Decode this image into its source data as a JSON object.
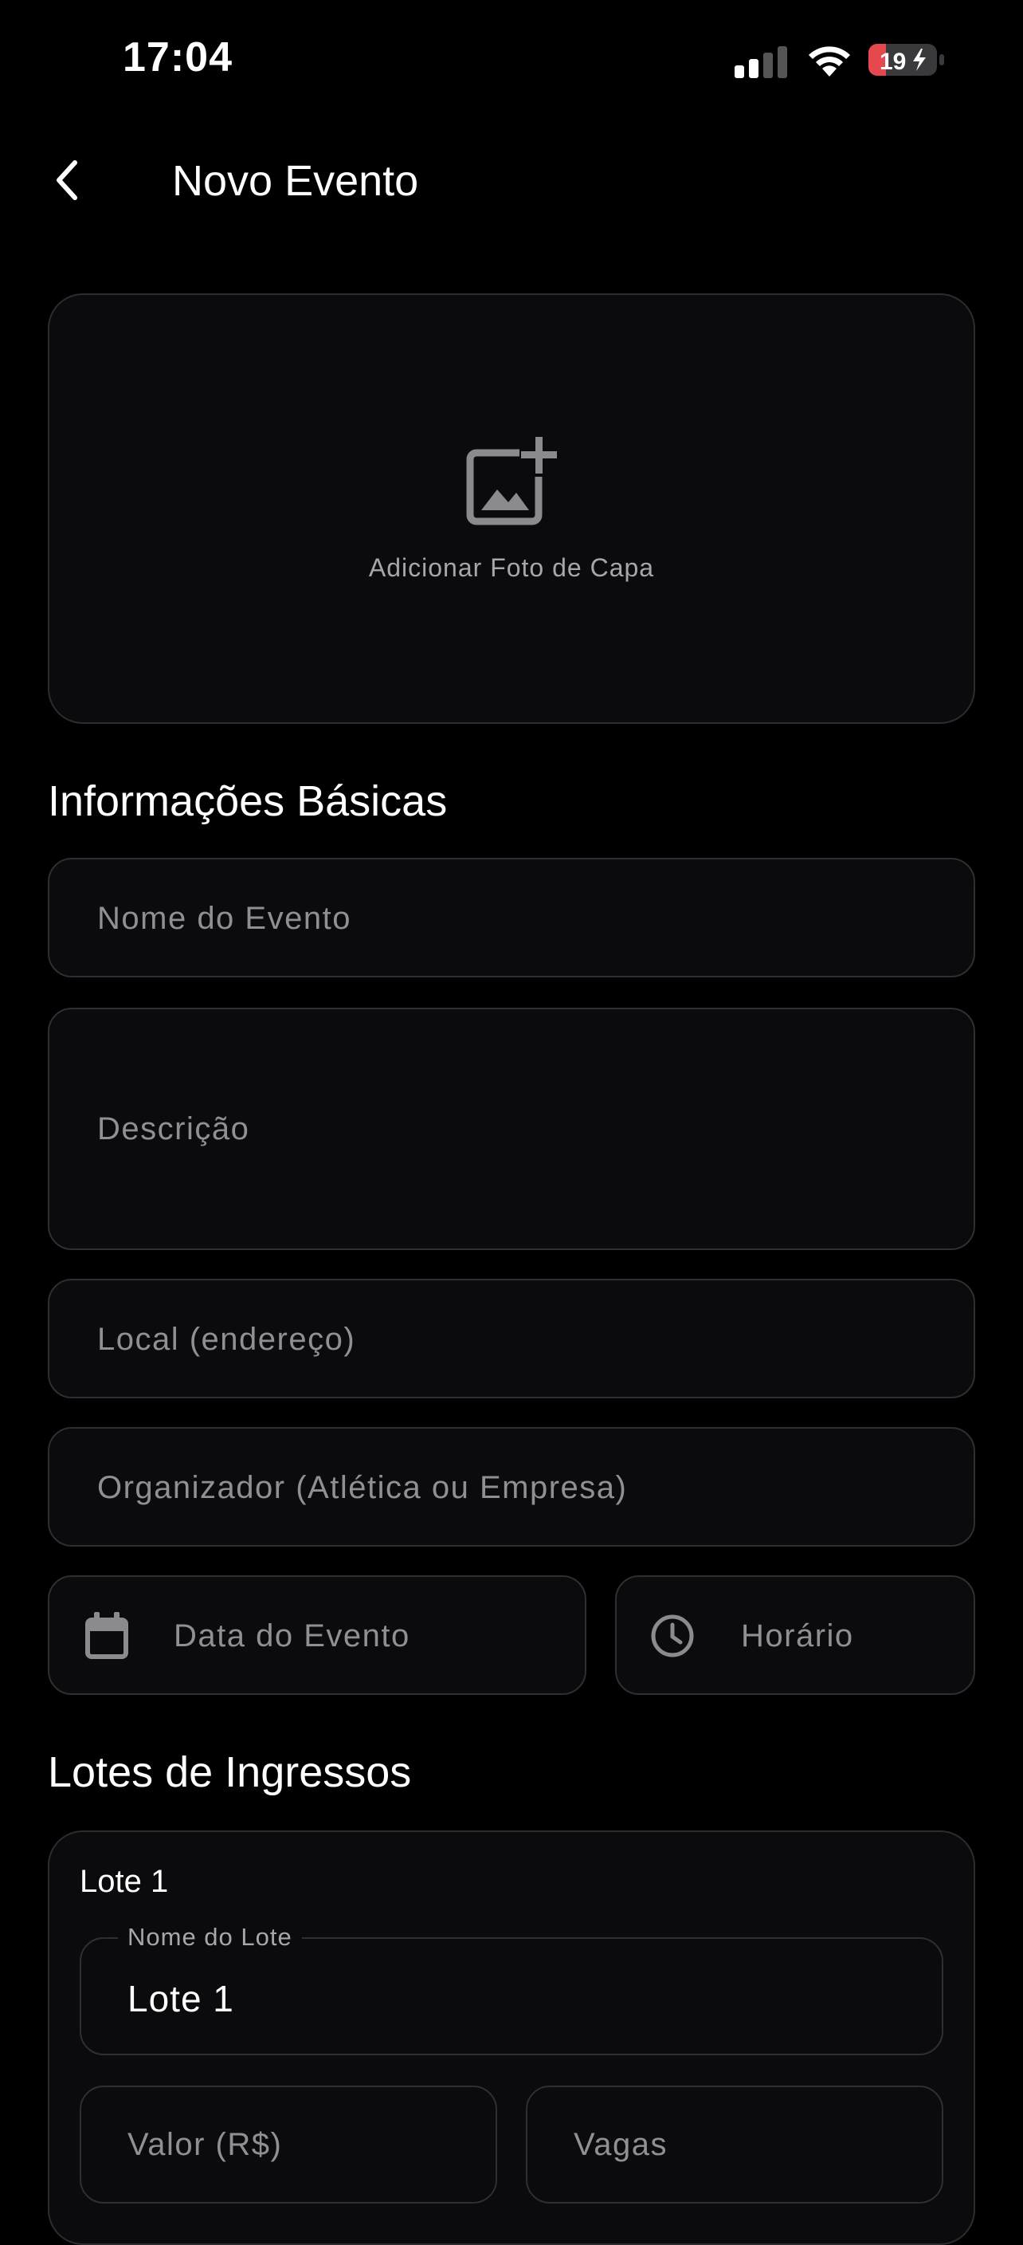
{
  "status_bar": {
    "time": "17:04",
    "battery": "19"
  },
  "header": {
    "title": "Novo Evento"
  },
  "cover": {
    "label": "Adicionar Foto de Capa"
  },
  "basic_info": {
    "title": "Informações Básicas",
    "event_name_placeholder": "Nome do Evento",
    "description_placeholder": "Descrição",
    "location_placeholder": "Local (endereço)",
    "organizer_placeholder": "Organizador (Atlética ou Empresa)",
    "date_placeholder": "Data do Evento",
    "time_placeholder": "Horário"
  },
  "tickets": {
    "title": "Lotes de Ingressos",
    "lots": [
      {
        "title": "Lote 1",
        "name_label": "Nome do Lote",
        "name_value": "Lote 1",
        "price_placeholder": "Valor (R$)",
        "slots_placeholder": "Vagas"
      }
    ]
  },
  "colors": {
    "background": "#000000",
    "surface": "#0b0b0d",
    "border": "#2e2e33",
    "placeholder": "#8f8f95",
    "battery_low": "#e5484d"
  }
}
